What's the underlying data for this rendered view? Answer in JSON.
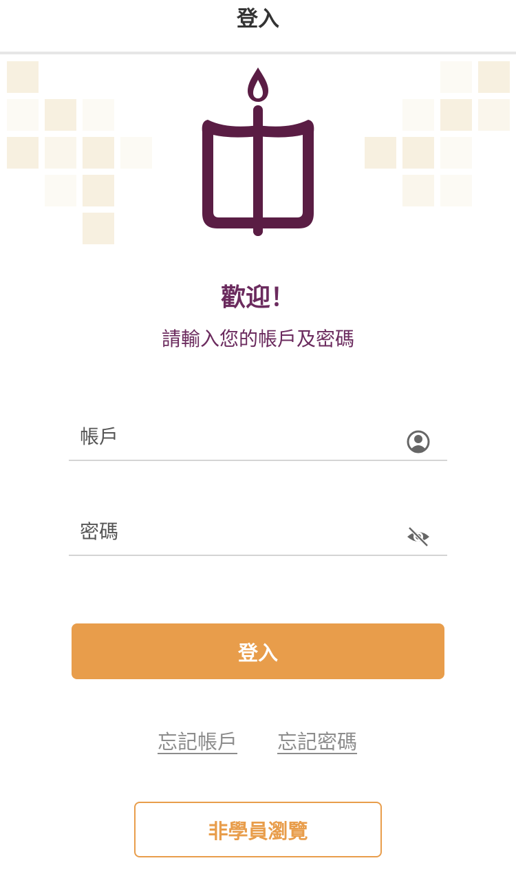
{
  "header": {
    "title": "登入"
  },
  "welcome": {
    "title": "歡迎！",
    "subtitle": "請輸入您的帳戶及密碼"
  },
  "form": {
    "account_placeholder": "帳戶",
    "account_icon": "user-circle-icon",
    "password_placeholder": "密碼",
    "password_icon": "eye-slash-icon",
    "login_label": "登入"
  },
  "links": {
    "forgot_account": "忘記帳戶",
    "forgot_password": "忘記密碼"
  },
  "guest": {
    "label": "非學員瀏覽"
  },
  "colors": {
    "brand_purple": "#6b2b5e",
    "logo_purple": "#5a1d44",
    "accent_orange": "#e89d4b",
    "tile_beige": "#f7f0e0"
  }
}
